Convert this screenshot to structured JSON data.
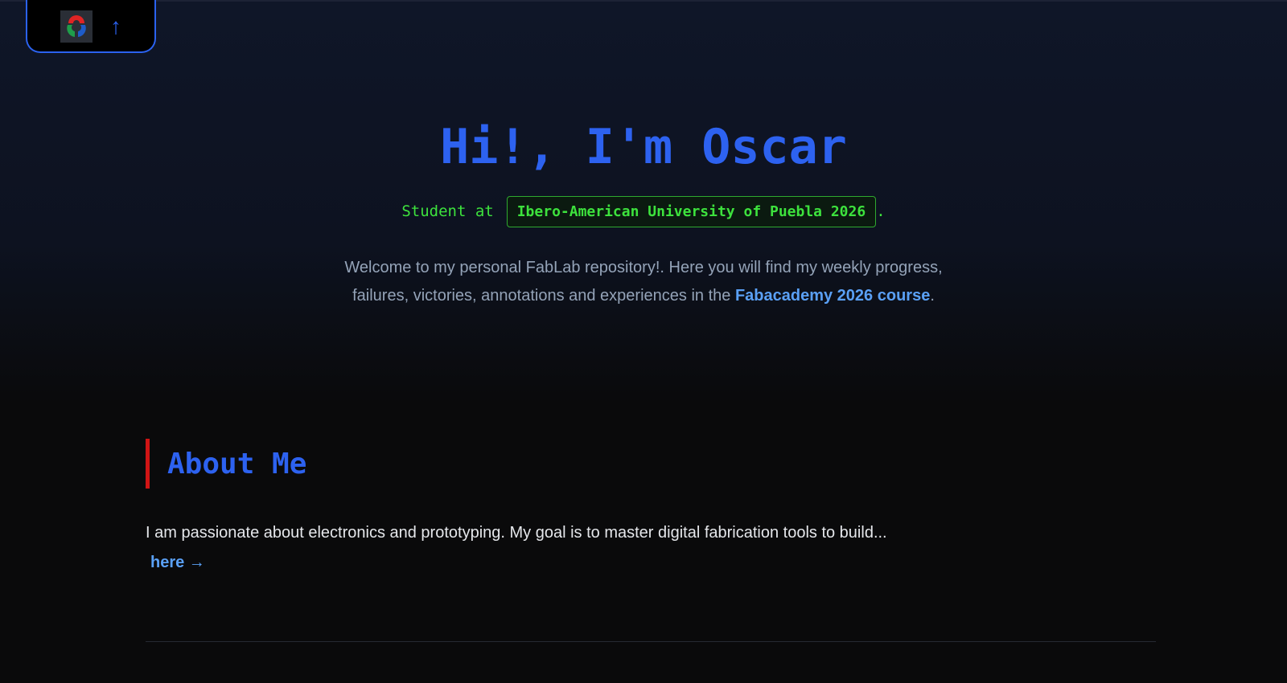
{
  "nav": {
    "logo": "fabacademy-logo",
    "up_icon": "↑"
  },
  "hero": {
    "title": "Hi!, I'm Oscar",
    "subtitle_prefix": "Student at",
    "university": "Ibero-American University of Puebla 2026",
    "subtitle_suffix": ".",
    "welcome_text": "Welcome to my personal FabLab repository!. Here you will find my weekly progress, failures, victories, annotations and experiences in the ",
    "welcome_link": "Fabacademy 2026 course",
    "welcome_end": "."
  },
  "about": {
    "heading": "About Me",
    "text": "I am passionate about electronics and prototyping. My goal is to master digital fabrication tools to build...",
    "link": "here →"
  },
  "colors": {
    "accent": "#2d62f0",
    "green": "#3de23d",
    "red": "#d01414",
    "link": "#5aa0f5"
  }
}
